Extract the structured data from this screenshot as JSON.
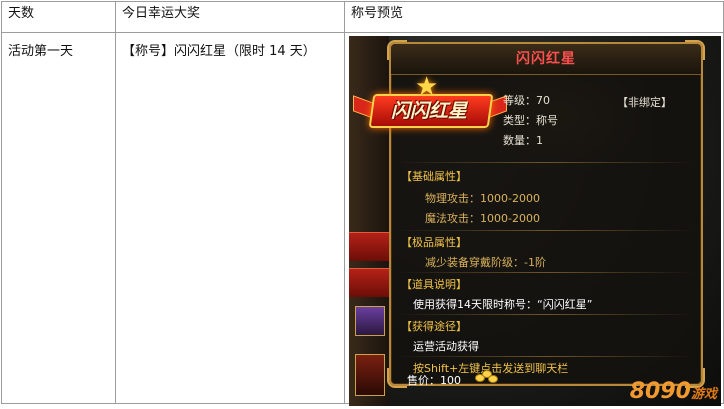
{
  "table": {
    "headers": [
      "天数",
      "今日幸运大奖",
      "称号预览"
    ],
    "row": {
      "day": "活动第一天",
      "prize": "【称号】闪闪红星（限时 14 天）"
    }
  },
  "preview": {
    "title": "闪闪红星",
    "badge_text": "闪闪红星",
    "level_label": "等级：70",
    "type_label": "类型：称号",
    "bind_status": "【非绑定】",
    "quantity": "数量：1",
    "sections": {
      "base_attr": "【基础属性】",
      "physical_attack": "物理攻击：1000-2000",
      "magic_attack": "魔法攻击：1000-2000",
      "premium_attr": "【极品属性】",
      "equip_req": "减少装备穿戴阶级：-1阶",
      "item_desc": "【道具说明】",
      "desc_text": "使用获得14天限时称号：“闪闪红星”",
      "obtain": "【获得途径】",
      "obtain_text": "运营活动获得"
    },
    "chat_hint": "按Shift+左键点击发送到聊天栏",
    "price": "售价：100",
    "watermark": "8090",
    "watermark_small": "游戏"
  },
  "colors": {
    "border": "#9c9c9c",
    "title_red": "#ff5050",
    "section_yellow": "#f0c24a",
    "frame_gold": "#b8893c"
  }
}
